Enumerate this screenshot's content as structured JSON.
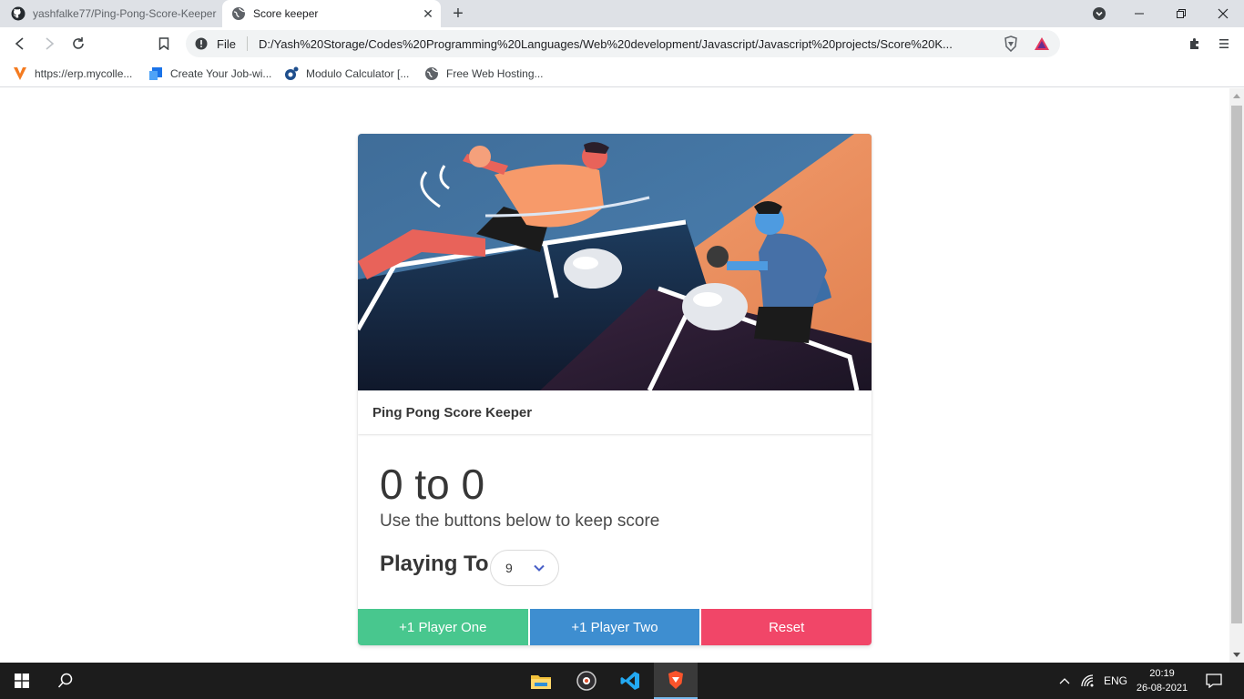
{
  "browser": {
    "tabs": [
      {
        "label": "yashfalke77/Ping-Pong-Score-Keeper",
        "icon": "github-icon",
        "active": false
      },
      {
        "label": "Score keeper",
        "icon": "globe-icon",
        "active": true
      }
    ],
    "new_tab_label": "+",
    "omnibox": {
      "scheme": "File",
      "url": "D:/Yash%20Storage/Codes%20Programming%20Languages/Web%20development/Javascript/Javascript%20projects/Score%20K..."
    },
    "bookmarks": [
      {
        "label": "https://erp.mycolle...",
        "icon": "v-logo-icon"
      },
      {
        "label": "Create Your Job-wi...",
        "icon": "page-icon"
      },
      {
        "label": "Modulo Calculator [...",
        "icon": "calculator-icon"
      },
      {
        "label": "Free Web Hosting...",
        "icon": "globe-icon"
      }
    ]
  },
  "page": {
    "card_title": "Ping Pong Score Keeper",
    "score": "0 to 0",
    "subtitle": "Use the buttons below to keep score",
    "playing_to_label": "Playing To",
    "playing_to_value": "9",
    "buttons": {
      "player_one": "+1 Player One",
      "player_two": "+1 Player Two",
      "reset": "Reset"
    },
    "colors": {
      "success": "#48c78e",
      "info": "#3e8ed0",
      "danger": "#f14668"
    }
  },
  "taskbar": {
    "language": "ENG",
    "time": "20:19",
    "date": "26-08-2021"
  }
}
